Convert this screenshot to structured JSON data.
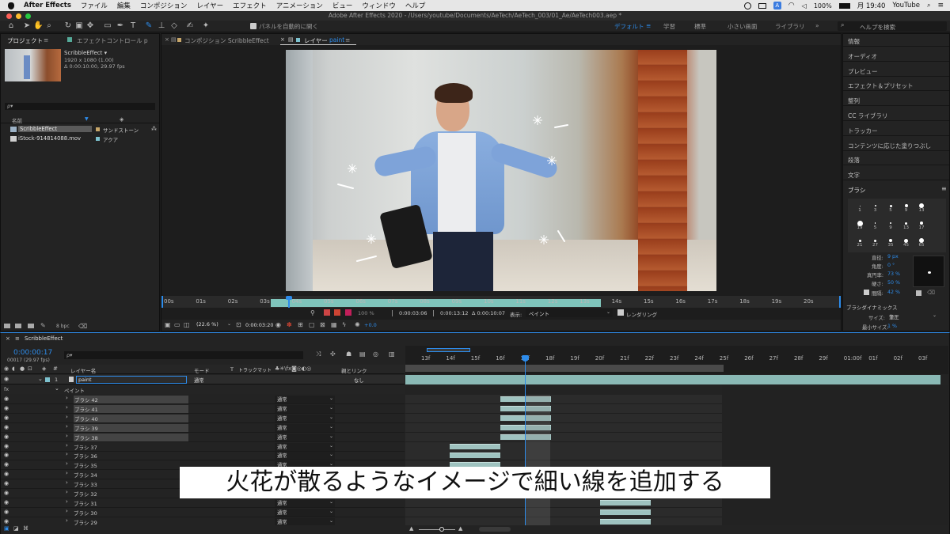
{
  "menubar": {
    "apple": "",
    "app": "After Effects",
    "items": [
      "ファイル",
      "編集",
      "コンポジション",
      "レイヤー",
      "エフェクト",
      "アニメーション",
      "ビュー",
      "ウィンドウ",
      "ヘルプ"
    ],
    "battery": "100%",
    "clock": "月 19:40",
    "user": "YouTube",
    "a_badge": "A"
  },
  "titlebar": {
    "title": "Adobe After Effects 2020 - /Users/youtube/Documents/AeTech/AeTech_003/01_Ae/AeTech003.aep *"
  },
  "toolbar": {
    "panel_checkbox_label": "パネルを自動的に開く",
    "workspaces": [
      "デフォルト",
      "学習",
      "標準",
      "小さい画面",
      "ライブラリ"
    ],
    "help_search_placeholder": "ヘルプを検索"
  },
  "project": {
    "tab_project": "プロジェクト",
    "tab_effect": "エフェクトコントロール p",
    "comp_name": "ScribbleEffect ▾",
    "comp_size": "1920 x 1080 (1.00)",
    "comp_duration": "Δ 0:00:10:00, 29.97 fps",
    "search_placeholder": "ρ▾",
    "col_name": "名前",
    "items": [
      {
        "name": "ScribbleEffect",
        "label": "サンドストーン",
        "color": "#c8a76a"
      },
      {
        "name": "iStock-914814088.mov",
        "label": "アクア",
        "color": "#7dc2cf"
      }
    ],
    "bpc": "8 bpc"
  },
  "viewer": {
    "tab_comp": "コンポジション ScribbleEffect",
    "tab_layer_prefix": "レイヤー",
    "tab_layer_name": "paint",
    "ruler": [
      "00s",
      "01s",
      "02s",
      "03s",
      "04s",
      "05s",
      "06s",
      "07s",
      "08s",
      "09s",
      "10s",
      "11s",
      "12s",
      "13s",
      "14s",
      "15s",
      "16s",
      "17s",
      "18s",
      "19s",
      "20s"
    ],
    "zoom": "(22.6 %)",
    "timecode": "0:00:03:20",
    "opacity": "100 %",
    "in_point": "0:00:03:06",
    "out_point": "0:00:13:12",
    "duration": "Δ 0:00:10:07",
    "view_label": "表示:",
    "view_value": "ペイント",
    "render_label": "レンダリング",
    "exposure": "+0.0"
  },
  "rightpanel": {
    "items": [
      "情報",
      "オーディオ",
      "プレビュー",
      "エフェクト＆プリセット",
      "整列",
      "CC ライブラリ",
      "トラッカー",
      "コンテンツに応じた塗りつぶし",
      "段落",
      "文字"
    ],
    "brush_title": "ブラシ",
    "brush_sizes": [
      "1",
      "3",
      "5",
      "9",
      "13",
      "19",
      "5",
      "9",
      "13",
      "17",
      "21",
      "27",
      "35",
      "45",
      "65"
    ],
    "diameter_label": "直径:",
    "diameter_value": "9 px",
    "angle_label": "角度:",
    "angle_value": "0 °",
    "roundness_label": "真円率:",
    "roundness_value": "73 %",
    "hardness_label": "硬さ:",
    "hardness_value": "50 %",
    "spacing_label": "間隔:",
    "spacing_value": "42 %",
    "dynamics_title": "ブラシダイナミックス",
    "size_label": "サイズ:",
    "size_value": "筆圧",
    "min_size_label": "最小サイズ:",
    "min_size_value": "1 %"
  },
  "timeline": {
    "tab": "ScribbleEffect",
    "timecode": "0:00:00:17",
    "frames": "00017 (29.97 fps)",
    "search_placeholder": "ρ▾",
    "col_layer_name": "レイヤー名",
    "col_mode": "モード",
    "col_t": "T",
    "col_trackmatte": "トラックマット",
    "col_parent": "親とリンク",
    "layer_num": "1",
    "layer_name": "paint",
    "layer_mode": "通常",
    "layer_parent": "なし",
    "group_label": "ペイント",
    "rows": [
      {
        "name": "ブラシ 42",
        "mode": "通常",
        "bar": [
          0.3,
          0.46
        ]
      },
      {
        "name": "ブラシ 41",
        "mode": "通常",
        "bar": [
          0.3,
          0.46
        ]
      },
      {
        "name": "ブラシ 40",
        "mode": "通常",
        "bar": [
          0.3,
          0.46
        ]
      },
      {
        "name": "ブラシ 39",
        "mode": "通常",
        "bar": [
          0.3,
          0.46
        ]
      },
      {
        "name": "ブラシ 38",
        "mode": "通常",
        "bar": [
          0.3,
          0.46
        ]
      },
      {
        "name": "ブラシ 37",
        "mode": "通常",
        "bar": [
          0.14,
          0.3
        ]
      },
      {
        "name": "ブラシ 36",
        "mode": "通常",
        "bar": [
          0.14,
          0.3
        ]
      },
      {
        "name": "ブラシ 35",
        "mode": "通常",
        "bar": [
          0.14,
          0.3
        ]
      },
      {
        "name": "ブラシ 34",
        "mode": "通常",
        "bar": null
      },
      {
        "name": "ブラシ 33",
        "mode": "通常",
        "bar": null
      },
      {
        "name": "ブラシ 32",
        "mode": "通常",
        "bar": null
      },
      {
        "name": "ブラシ 31",
        "mode": "通常",
        "bar": [
          0.615,
          0.775
        ]
      },
      {
        "name": "ブラシ 30",
        "mode": "通常",
        "bar": [
          0.615,
          0.775
        ]
      },
      {
        "name": "ブラシ 29",
        "mode": "通常",
        "bar": [
          0.615,
          0.775
        ]
      }
    ],
    "ruler": [
      "13f",
      "14f",
      "15f",
      "16f",
      "17f",
      "18f",
      "19f",
      "20f",
      "21f",
      "22f",
      "23f",
      "24f",
      "25f",
      "26f",
      "27f",
      "28f",
      "29f",
      "01:00f",
      "01f",
      "02f",
      "03f"
    ]
  },
  "subtitle": "火花が散るようなイメージで細い線を追加する"
}
